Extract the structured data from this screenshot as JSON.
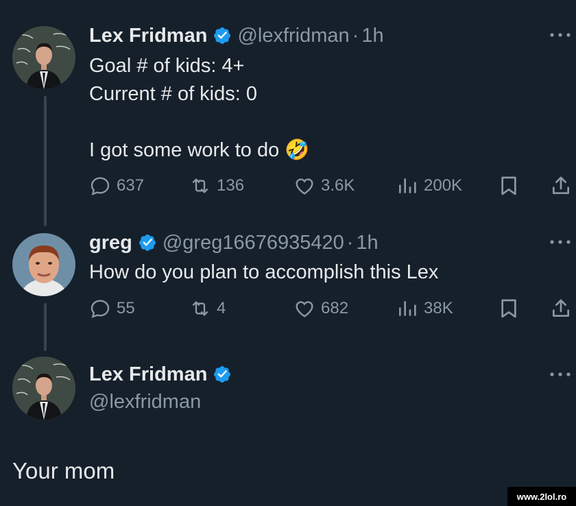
{
  "tweets": [
    {
      "name": "Lex Fridman",
      "handle": "@lexfridman",
      "separator": "·",
      "time": "1h",
      "text": "Goal # of kids: 4+\nCurrent # of kids: 0\n\nI got some work to do 🤣",
      "stats": {
        "replies": "637",
        "retweets": "136",
        "likes": "3.6K",
        "views": "200K"
      }
    },
    {
      "name": "greg",
      "handle": "@greg16676935420",
      "separator": "·",
      "time": "1h",
      "text": "How do you plan to accomplish this Lex",
      "stats": {
        "replies": "55",
        "retweets": "4",
        "likes": "682",
        "views": "38K"
      }
    },
    {
      "name": "Lex Fridman",
      "handle": "@lexfridman"
    }
  ],
  "reply_text": "Your mom",
  "watermark": "www.2lol.ro",
  "colors": {
    "background": "#15202b",
    "text": "#e7e9ea",
    "muted": "#8b98a5",
    "verified": "#1d9bf0"
  },
  "icons": [
    "verified-badge-icon",
    "more-icon",
    "reply-icon",
    "retweet-icon",
    "like-icon",
    "views-icon",
    "bookmark-icon",
    "share-icon"
  ]
}
